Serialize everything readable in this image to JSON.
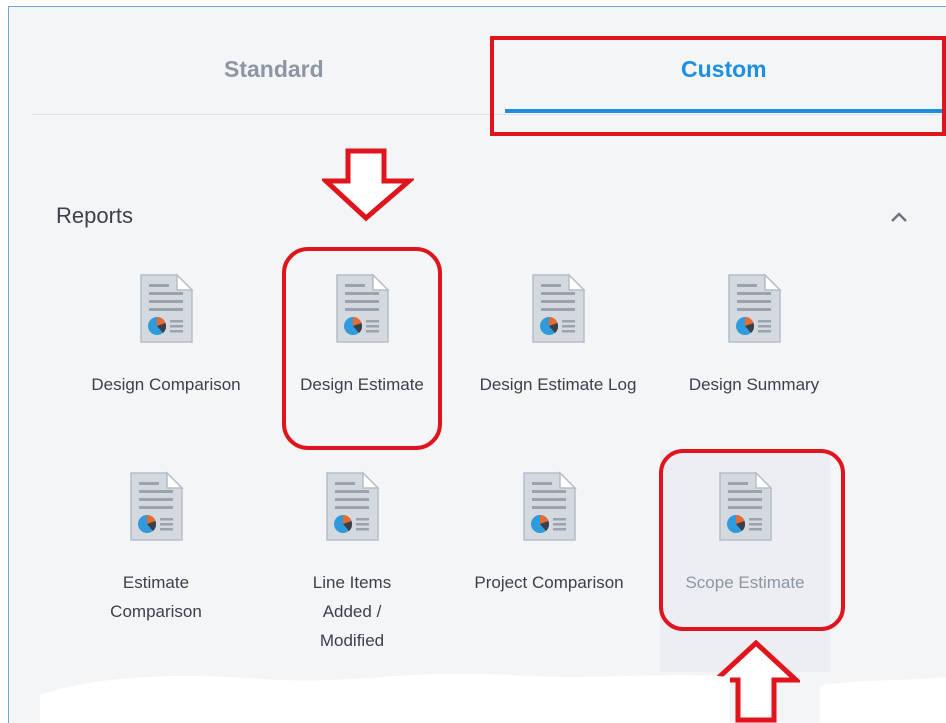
{
  "tabs": {
    "standard": "Standard",
    "custom": "Custom",
    "active": "custom"
  },
  "section": {
    "title": "Reports",
    "collapse_icon": "chevron-up-icon",
    "expanded": true
  },
  "reports": [
    {
      "label": "Design Comparison",
      "icon": "report-document-icon"
    },
    {
      "label": "Design Estimate",
      "icon": "report-document-icon"
    },
    {
      "label": "Design Estimate Log",
      "icon": "report-document-icon"
    },
    {
      "label": "Design Summary",
      "icon": "report-document-icon"
    },
    {
      "label": "Estimate Comparison",
      "icon": "report-document-icon"
    },
    {
      "label": "Line Items Added / Modified",
      "icon": "report-document-icon"
    },
    {
      "label": "Project Comparison",
      "icon": "report-document-icon"
    },
    {
      "label": "Scope Estimate",
      "icon": "report-document-icon",
      "selected": true
    }
  ],
  "colors": {
    "accent": "#1d8fe0",
    "annotation": "#e0141c",
    "panel_bg": "#f4f5f7",
    "text": "#3b414a",
    "muted_text": "#8d96a2",
    "icon_page": "#d4d9df",
    "icon_chart": "#2f9bdc"
  }
}
